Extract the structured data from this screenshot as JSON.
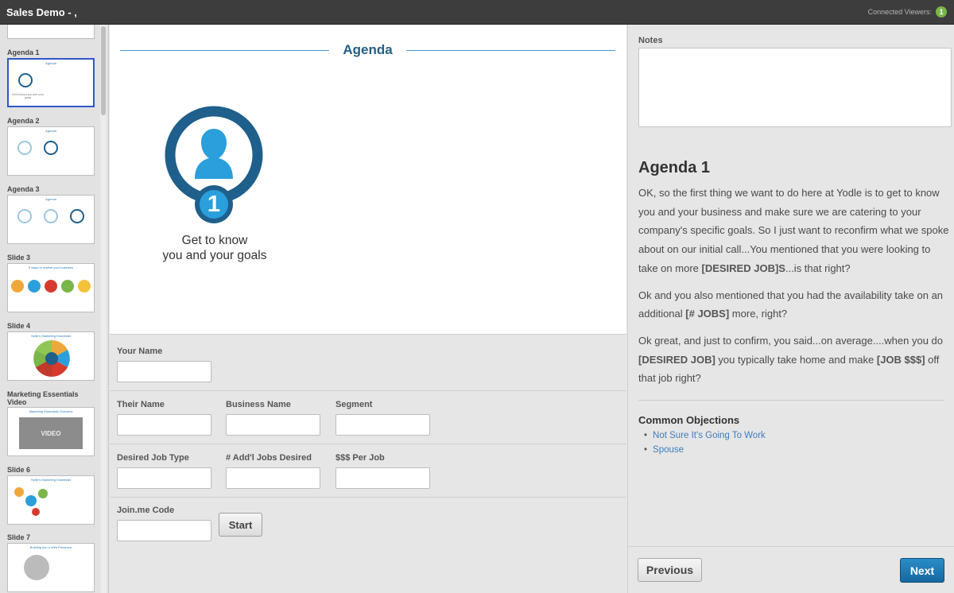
{
  "app": {
    "title": "Sales Demo - ,",
    "viewers_label": "Connected Viewers:",
    "viewers_count": "1"
  },
  "thumbnails": [
    {
      "label": "Agenda 1",
      "mini_title": "Agenda",
      "mini_caption": "Get to know you and your goals"
    },
    {
      "label": "Agenda 2",
      "mini_title": "Agenda"
    },
    {
      "label": "Agenda 3",
      "mini_title": "Agenda"
    },
    {
      "label": "Slide 3",
      "mini_title": "5 ways to market your business"
    },
    {
      "label": "Slide 4",
      "mini_title": "Yodle's Marketing Essentials"
    },
    {
      "label": "Marketing Essentials Video",
      "mini_title": "Marketing Essentials Overview",
      "video_label": "VIDEO"
    },
    {
      "label": "Slide 6",
      "mini_title": "Yodle's Marketing Essentials"
    },
    {
      "label": "Slide 7",
      "mini_title": "Building you a Web Presence"
    }
  ],
  "slide": {
    "title": "Agenda",
    "badge_number": "1",
    "caption_line1": "Get to know",
    "caption_line2": "you and your goals"
  },
  "form": {
    "your_name_label": "Your Name",
    "their_name_label": "Their Name",
    "business_name_label": "Business Name",
    "segment_label": "Segment",
    "desired_job_type_label": "Desired Job Type",
    "addl_jobs_label": "# Add'l Jobs Desired",
    "per_job_label": "$$$ Per Job",
    "joinme_label": "Join.me Code",
    "start_label": "Start"
  },
  "notes": {
    "label": "Notes"
  },
  "script": {
    "title": "Agenda 1",
    "p1_a": "OK, so the first thing we want to do here at Yodle is to get to know you and your business and make sure we are catering to your company's specific goals. So I just want to reconfirm what we spoke about on our initial call...You mentioned that you were looking to take on more ",
    "p1_b": "[DESIRED JOB]S",
    "p1_c": "...is that right?",
    "p2_a": "Ok and you also mentioned that you had the availability take on an additional ",
    "p2_b": "[# JOBS]",
    "p2_c": " more, right?",
    "p3_a": "Ok great, and just to confirm, you said...on average....when you do ",
    "p3_b": "[DESIRED JOB]",
    "p3_c": " you typically take home and make ",
    "p3_d": "[JOB $$$]",
    "p3_e": " off that job right?"
  },
  "objections": {
    "title": "Common Objections",
    "items": [
      "Not Sure It's Going To Work",
      "Spouse"
    ]
  },
  "nav": {
    "previous_label": "Previous",
    "next_label": "Next"
  },
  "colors": {
    "accent": "#1f5f8b",
    "link": "#3c7dbf",
    "badge": "#7ab648"
  }
}
